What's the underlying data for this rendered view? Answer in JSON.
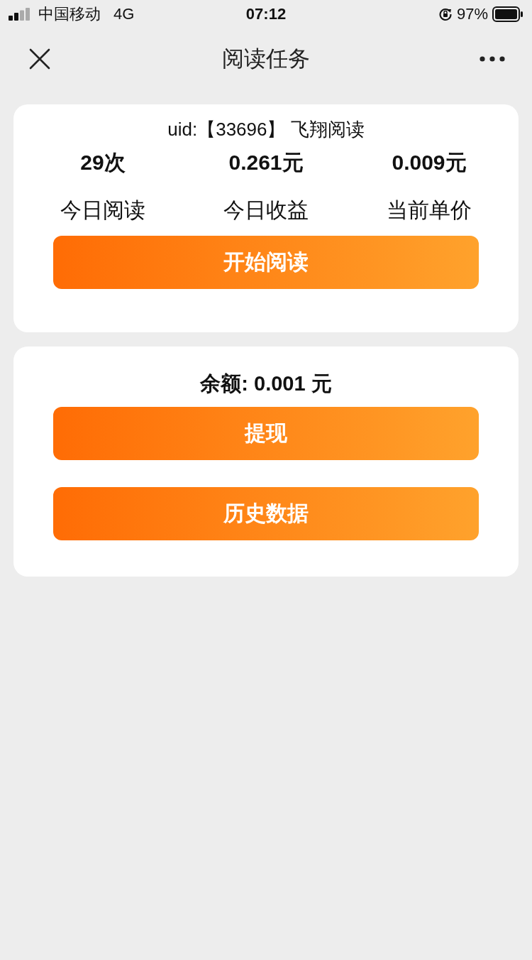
{
  "status_bar": {
    "carrier": "中国移动",
    "network": "4G",
    "time": "07:12",
    "battery": "97%"
  },
  "nav": {
    "title": "阅读任务"
  },
  "task_card": {
    "uid_line": "uid:【33696】 飞翔阅读",
    "stats": [
      {
        "value": "29次",
        "label": "今日阅读"
      },
      {
        "value": "0.261元",
        "label": "今日收益"
      },
      {
        "value": "0.009元",
        "label": "当前单价"
      }
    ],
    "button": "开始阅读"
  },
  "balance_card": {
    "balance": "余额: 0.001 元",
    "buttons": [
      "提现",
      "历史数据"
    ]
  }
}
